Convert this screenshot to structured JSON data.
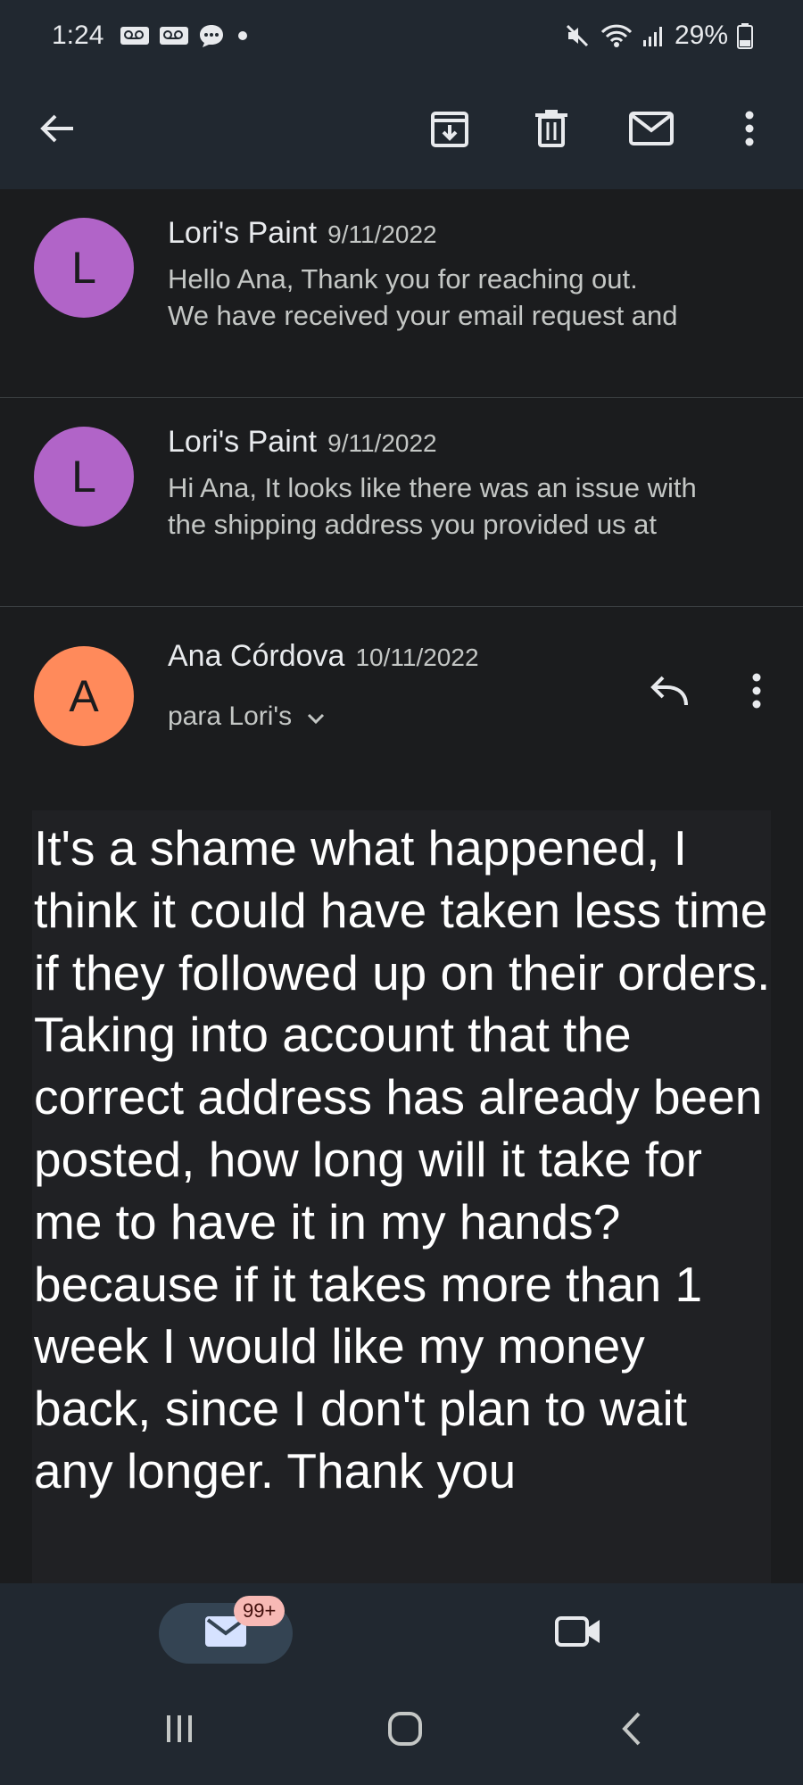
{
  "status_bar": {
    "time": "1:24",
    "battery": "29%",
    "icons_left": [
      "voicemail-icon",
      "voicemail-icon",
      "chat-bubble-icon",
      "dot-icon"
    ],
    "icons_right": [
      "mute-icon",
      "wifi-icon",
      "signal-icon",
      "battery-icon"
    ]
  },
  "app_bar": {
    "actions": [
      "back-arrow-icon",
      "archive-icon",
      "delete-icon",
      "mark-unread-icon",
      "more-options-icon"
    ]
  },
  "messages": [
    {
      "avatar_letter": "L",
      "sender": "Lori's Paint",
      "date": "9/11/2022",
      "snippet_line1": "Hello Ana, Thank you for reaching out.",
      "snippet_line2": "We have received your email request and"
    },
    {
      "avatar_letter": "L",
      "sender": "Lori's Paint",
      "date": "9/11/2022",
      "snippet_line1": "Hi Ana, It looks like there was an issue with",
      "snippet_line2": "the shipping address you provided us at"
    }
  ],
  "expanded": {
    "avatar_letter": "A",
    "sender": "Ana Córdova",
    "date": "10/11/2022",
    "recipient": "para Lori's",
    "body": "It's a shame what happened, I think it could have taken less time if they followed up on their orders. Taking into account that the correct address has already been posted, how long will it take for me to have it in my hands? because if it takes more than 1 week I would like my money back, since I don't plan to wait any longer. Thank you"
  },
  "bottom_nav": {
    "mail_badge": "99+"
  },
  "colors": {
    "background": "#1b1c1e",
    "bar": "#212830",
    "avatar_purple": "#b164c8",
    "avatar_orange": "#ff8a5b",
    "badge": "#f7b9b5"
  }
}
